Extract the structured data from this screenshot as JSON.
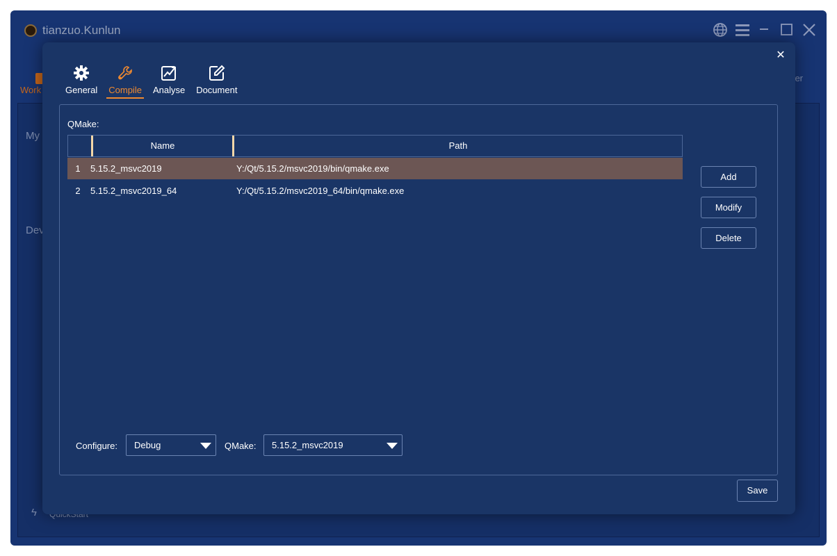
{
  "app": {
    "title": "tianzuo.Kunlun",
    "background": {
      "work_label": "Work",
      "my_label": "My",
      "dev_label": "Dev",
      "er_label": "er",
      "quickstart_label": "QuickStart"
    }
  },
  "dialog": {
    "close_label": "✕",
    "tabs": [
      {
        "label": "General",
        "icon": "gear-icon",
        "active": false
      },
      {
        "label": "Compile",
        "icon": "wrench-icon",
        "active": true
      },
      {
        "label": "Analyse",
        "icon": "chart-icon",
        "active": false
      },
      {
        "label": "Document",
        "icon": "edit-icon",
        "active": false
      }
    ],
    "qmake_section_label": "QMake:",
    "table": {
      "headers": {
        "index": "",
        "name": "Name",
        "path": "Path"
      },
      "rows": [
        {
          "index": "1",
          "name": "5.15.2_msvc2019",
          "path": "Y:/Qt/5.15.2/msvc2019/bin/qmake.exe",
          "selected": true
        },
        {
          "index": "2",
          "name": "5.15.2_msvc2019_64",
          "path": "Y:/Qt/5.15.2/msvc2019_64/bin/qmake.exe",
          "selected": false
        }
      ]
    },
    "buttons": {
      "add": "Add",
      "modify": "Modify",
      "delete": "Delete",
      "save": "Save"
    },
    "configure_label": "Configure:",
    "configure_value": "Debug",
    "qmake_select_label": "QMake:",
    "qmake_select_value": "5.15.2_msvc2019"
  },
  "colors": {
    "accent": "#f08a30",
    "selected_row": "#6c5654",
    "dialog_bg": "#1a3566",
    "window_bg": "#173472"
  }
}
